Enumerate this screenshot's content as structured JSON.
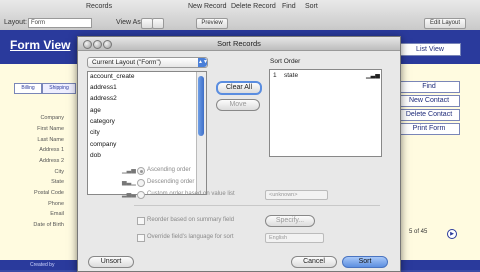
{
  "toolbar": {
    "records_label": "Records",
    "layout_label": "Layout:",
    "layout_value": "Form",
    "view_as_label": "View As:",
    "preview_label": "Preview",
    "new_record_label": "New Record",
    "delete_record_label": "Delete Record",
    "find_label": "Find",
    "sort_label": "Sort",
    "edit_layout_label": "Edit Layout"
  },
  "header": {
    "form_view_label": "Form View",
    "list_view_label": "List View"
  },
  "form": {
    "tabs": [
      "Billing",
      "Shipping"
    ],
    "field_labels": [
      "Company",
      "First Name",
      "Last Name",
      "Address 1",
      "Address 2",
      "City",
      "State",
      "Postal Code",
      "Phone",
      "Email",
      "Date of Birth"
    ],
    "side_buttons": [
      "Find",
      "New Contact",
      "Delete Contact",
      "Print Form"
    ],
    "page_count": "5 of 45",
    "created_by": "Created by"
  },
  "dialog": {
    "title": "Sort Records",
    "layout_select": "Current Layout (\"Form\")",
    "fields": [
      "account_create",
      "address1",
      "address2",
      "age",
      "category",
      "city",
      "company",
      "dob"
    ],
    "clear_all_label": "Clear All",
    "move_label": "Move",
    "sort_order_label": "Sort Order",
    "sort_order_items": [
      {
        "num": "1",
        "field": "state"
      }
    ],
    "ascending_label": "Ascending order",
    "descending_label": "Descending order",
    "custom_label": "Custom order based on value list",
    "value_list_placeholder": "<unknown>",
    "reorder_label": "Reorder based on summary field",
    "specify_label": "Specify...",
    "override_label": "Override field's language for sort",
    "language_value": "English",
    "unsort_label": "Unsort",
    "cancel_label": "Cancel",
    "sort_label": "Sort"
  },
  "colors": {
    "header_blue": "#2a3a9c",
    "form_bg": "#fffbe0",
    "sort_button_blue": "#5d8fe0"
  }
}
